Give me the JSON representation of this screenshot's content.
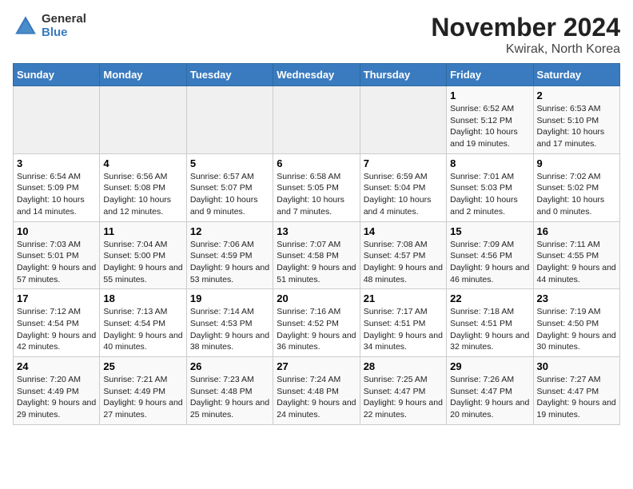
{
  "logo": {
    "general": "General",
    "blue": "Blue"
  },
  "title": "November 2024",
  "location": "Kwirak, North Korea",
  "days_of_week": [
    "Sunday",
    "Monday",
    "Tuesday",
    "Wednesday",
    "Thursday",
    "Friday",
    "Saturday"
  ],
  "weeks": [
    [
      {
        "day": "",
        "info": ""
      },
      {
        "day": "",
        "info": ""
      },
      {
        "day": "",
        "info": ""
      },
      {
        "day": "",
        "info": ""
      },
      {
        "day": "",
        "info": ""
      },
      {
        "day": "1",
        "info": "Sunrise: 6:52 AM\nSunset: 5:12 PM\nDaylight: 10 hours and 19 minutes."
      },
      {
        "day": "2",
        "info": "Sunrise: 6:53 AM\nSunset: 5:10 PM\nDaylight: 10 hours and 17 minutes."
      }
    ],
    [
      {
        "day": "3",
        "info": "Sunrise: 6:54 AM\nSunset: 5:09 PM\nDaylight: 10 hours and 14 minutes."
      },
      {
        "day": "4",
        "info": "Sunrise: 6:56 AM\nSunset: 5:08 PM\nDaylight: 10 hours and 12 minutes."
      },
      {
        "day": "5",
        "info": "Sunrise: 6:57 AM\nSunset: 5:07 PM\nDaylight: 10 hours and 9 minutes."
      },
      {
        "day": "6",
        "info": "Sunrise: 6:58 AM\nSunset: 5:05 PM\nDaylight: 10 hours and 7 minutes."
      },
      {
        "day": "7",
        "info": "Sunrise: 6:59 AM\nSunset: 5:04 PM\nDaylight: 10 hours and 4 minutes."
      },
      {
        "day": "8",
        "info": "Sunrise: 7:01 AM\nSunset: 5:03 PM\nDaylight: 10 hours and 2 minutes."
      },
      {
        "day": "9",
        "info": "Sunrise: 7:02 AM\nSunset: 5:02 PM\nDaylight: 10 hours and 0 minutes."
      }
    ],
    [
      {
        "day": "10",
        "info": "Sunrise: 7:03 AM\nSunset: 5:01 PM\nDaylight: 9 hours and 57 minutes."
      },
      {
        "day": "11",
        "info": "Sunrise: 7:04 AM\nSunset: 5:00 PM\nDaylight: 9 hours and 55 minutes."
      },
      {
        "day": "12",
        "info": "Sunrise: 7:06 AM\nSunset: 4:59 PM\nDaylight: 9 hours and 53 minutes."
      },
      {
        "day": "13",
        "info": "Sunrise: 7:07 AM\nSunset: 4:58 PM\nDaylight: 9 hours and 51 minutes."
      },
      {
        "day": "14",
        "info": "Sunrise: 7:08 AM\nSunset: 4:57 PM\nDaylight: 9 hours and 48 minutes."
      },
      {
        "day": "15",
        "info": "Sunrise: 7:09 AM\nSunset: 4:56 PM\nDaylight: 9 hours and 46 minutes."
      },
      {
        "day": "16",
        "info": "Sunrise: 7:11 AM\nSunset: 4:55 PM\nDaylight: 9 hours and 44 minutes."
      }
    ],
    [
      {
        "day": "17",
        "info": "Sunrise: 7:12 AM\nSunset: 4:54 PM\nDaylight: 9 hours and 42 minutes."
      },
      {
        "day": "18",
        "info": "Sunrise: 7:13 AM\nSunset: 4:54 PM\nDaylight: 9 hours and 40 minutes."
      },
      {
        "day": "19",
        "info": "Sunrise: 7:14 AM\nSunset: 4:53 PM\nDaylight: 9 hours and 38 minutes."
      },
      {
        "day": "20",
        "info": "Sunrise: 7:16 AM\nSunset: 4:52 PM\nDaylight: 9 hours and 36 minutes."
      },
      {
        "day": "21",
        "info": "Sunrise: 7:17 AM\nSunset: 4:51 PM\nDaylight: 9 hours and 34 minutes."
      },
      {
        "day": "22",
        "info": "Sunrise: 7:18 AM\nSunset: 4:51 PM\nDaylight: 9 hours and 32 minutes."
      },
      {
        "day": "23",
        "info": "Sunrise: 7:19 AM\nSunset: 4:50 PM\nDaylight: 9 hours and 30 minutes."
      }
    ],
    [
      {
        "day": "24",
        "info": "Sunrise: 7:20 AM\nSunset: 4:49 PM\nDaylight: 9 hours and 29 minutes."
      },
      {
        "day": "25",
        "info": "Sunrise: 7:21 AM\nSunset: 4:49 PM\nDaylight: 9 hours and 27 minutes."
      },
      {
        "day": "26",
        "info": "Sunrise: 7:23 AM\nSunset: 4:48 PM\nDaylight: 9 hours and 25 minutes."
      },
      {
        "day": "27",
        "info": "Sunrise: 7:24 AM\nSunset: 4:48 PM\nDaylight: 9 hours and 24 minutes."
      },
      {
        "day": "28",
        "info": "Sunrise: 7:25 AM\nSunset: 4:47 PM\nDaylight: 9 hours and 22 minutes."
      },
      {
        "day": "29",
        "info": "Sunrise: 7:26 AM\nSunset: 4:47 PM\nDaylight: 9 hours and 20 minutes."
      },
      {
        "day": "30",
        "info": "Sunrise: 7:27 AM\nSunset: 4:47 PM\nDaylight: 9 hours and 19 minutes."
      }
    ]
  ]
}
